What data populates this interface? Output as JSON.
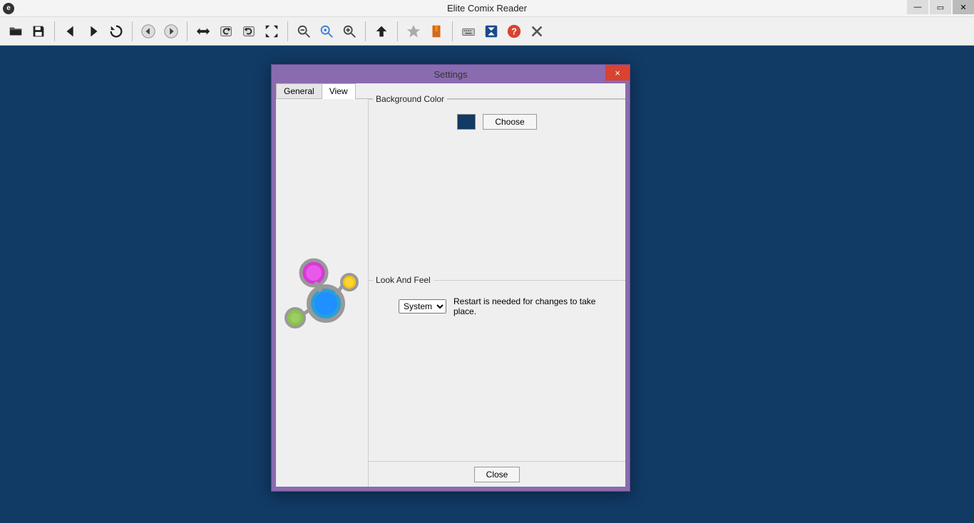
{
  "app": {
    "title": "Elite Comix Reader"
  },
  "dialog": {
    "title": "Settings",
    "tabs": {
      "general": "General",
      "view": "View"
    },
    "bg": {
      "legend": "Background Color",
      "choose": "Choose",
      "swatch": "#113a65"
    },
    "look": {
      "legend": "Look And Feel",
      "selected": "System",
      "hint": "Restart is needed for changes to take place."
    },
    "close": "Close"
  }
}
